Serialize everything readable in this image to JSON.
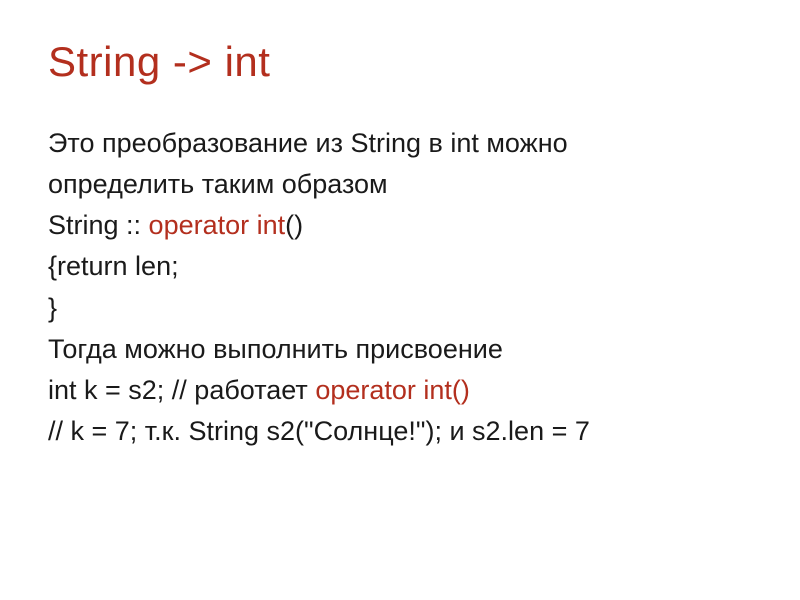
{
  "title": "String -> int",
  "lines": {
    "l1": "Это преобразование  из String в int можно",
    "l2": "определить таким образом",
    "l3a": "String :: ",
    "l3b": "operator int",
    "l3c": "()",
    "l4": "{return len;",
    "l5": "}",
    "l6": "Тогда можно выполнить присвоение",
    "l7a": "int k = s2; // работает ",
    "l7b": "operator int()",
    "l8": "// k = 7; т.к. String s2(\"Солнце!\"); и s2.len = 7"
  }
}
